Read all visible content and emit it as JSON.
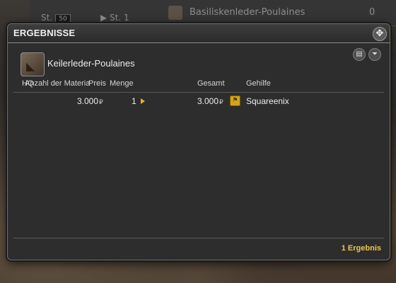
{
  "background_window": {
    "st_label_1": "St.",
    "st_value": "50",
    "st_label_2": "▶ St. 1",
    "item_name": "Basiliskenleder-Poulaines",
    "count": "0"
  },
  "window": {
    "title": "ERGEBNISSE",
    "close_icon": "✥",
    "item_name": "Keilerleder-Poulaines"
  },
  "columns": {
    "hq": "HQ",
    "materia": "Anzahl der Materia",
    "price": "Preis",
    "quantity": "Menge",
    "total": "Gesamt",
    "retainer": "Gehilfe"
  },
  "rows": [
    {
      "price": "3.000",
      "currency": "₽",
      "quantity": "1",
      "total": "3.000",
      "retainer": "Squareenix"
    }
  ],
  "footer": {
    "result_count": "1 Ergebnis"
  },
  "colors": {
    "accent_gold": "#f0c64a",
    "arrow_gold": "#e9b80d"
  }
}
